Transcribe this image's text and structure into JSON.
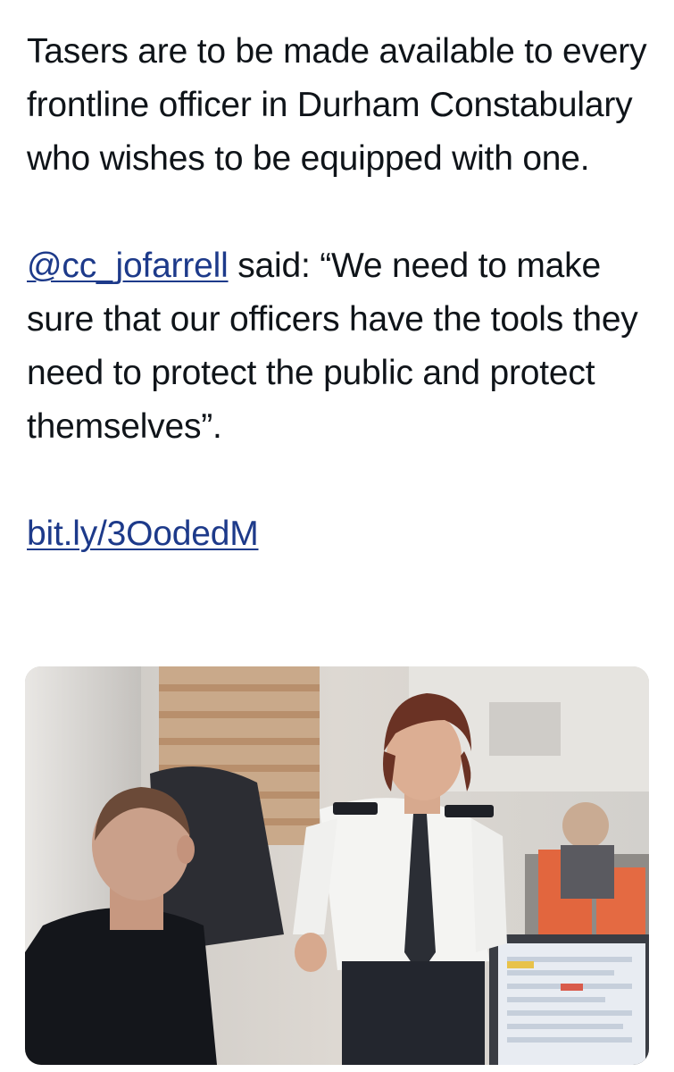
{
  "tweet": {
    "paragraph_1": "Tasers are to be made available to every frontline officer in Durham Constabulary who wishes to be equipped with one.",
    "mention": "@cc_jofarrell",
    "quote_text": " said: “We need to make sure that our officers have the tools they need to protect the public and protect themselves”.",
    "link": "bit.ly/3OodedM"
  },
  "colors": {
    "text": "#0f1419",
    "link": "#1d3a8a"
  },
  "media": {
    "icon": "photo-of-officers-in-office"
  }
}
